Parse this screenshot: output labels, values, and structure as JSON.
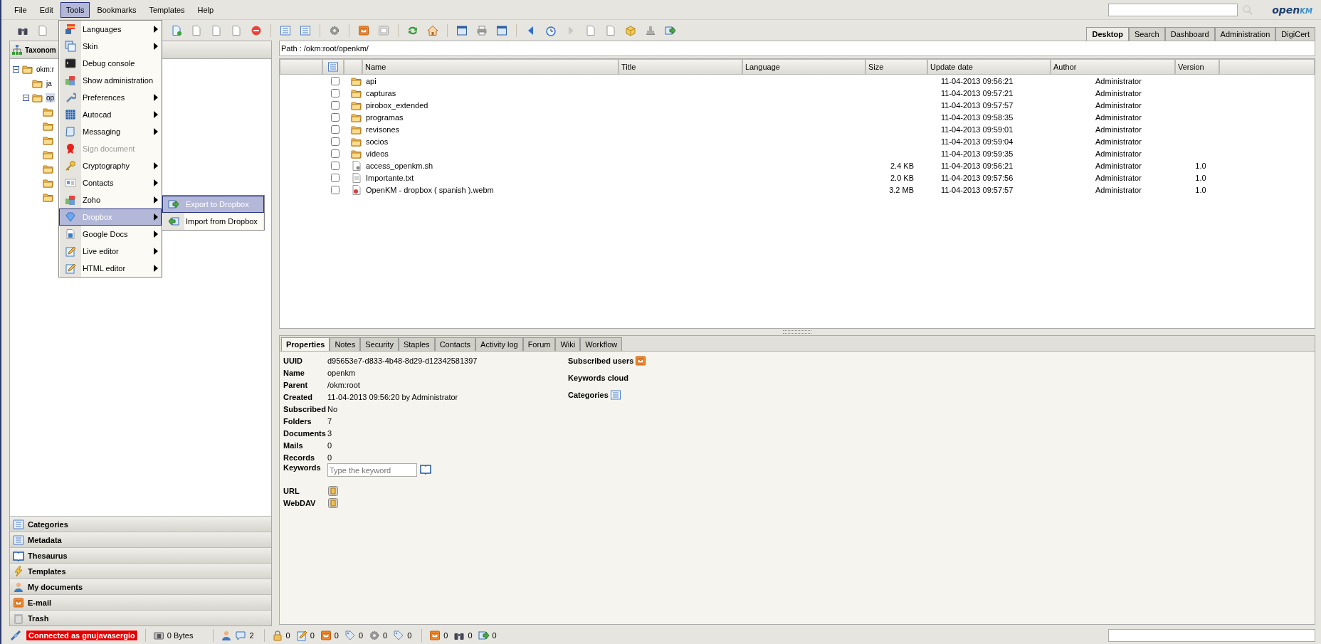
{
  "menu_bar": [
    {
      "label": "File",
      "selected": false
    },
    {
      "label": "Edit",
      "selected": false
    },
    {
      "label": "Tools",
      "selected": true
    },
    {
      "label": "Bookmarks",
      "selected": false
    },
    {
      "label": "Templates",
      "selected": false
    },
    {
      "label": "Help",
      "selected": false
    }
  ],
  "logo": {
    "main": "open",
    "tail": "KM"
  },
  "view_tabs": [
    {
      "label": "Desktop",
      "selected": true
    },
    {
      "label": "Search",
      "selected": false
    },
    {
      "label": "Dashboard",
      "selected": false
    },
    {
      "label": "Administration",
      "selected": false
    },
    {
      "label": "DigiCert",
      "selected": false
    }
  ],
  "tools_menu": [
    {
      "label": "Languages",
      "submenu": true,
      "disabled": false,
      "selected": false
    },
    {
      "label": "Skin",
      "submenu": true,
      "disabled": false,
      "selected": false
    },
    {
      "label": "Debug console",
      "submenu": false,
      "disabled": false,
      "selected": false
    },
    {
      "label": "Show administration",
      "submenu": false,
      "disabled": false,
      "selected": false
    },
    {
      "label": "Preferences",
      "submenu": true,
      "disabled": false,
      "selected": false
    },
    {
      "label": "Autocad",
      "submenu": true,
      "disabled": false,
      "selected": false
    },
    {
      "label": "Messaging",
      "submenu": true,
      "disabled": false,
      "selected": false
    },
    {
      "label": "Sign document",
      "submenu": false,
      "disabled": true,
      "selected": false
    },
    {
      "label": "Cryptography",
      "submenu": true,
      "disabled": false,
      "selected": false
    },
    {
      "label": "Contacts",
      "submenu": true,
      "disabled": false,
      "selected": false
    },
    {
      "label": "Zoho",
      "submenu": true,
      "disabled": false,
      "selected": false
    },
    {
      "label": "Dropbox",
      "submenu": true,
      "disabled": false,
      "selected": true
    },
    {
      "label": "Google Docs",
      "submenu": true,
      "disabled": false,
      "selected": false
    },
    {
      "label": "Live editor",
      "submenu": true,
      "disabled": false,
      "selected": false
    },
    {
      "label": "HTML editor",
      "submenu": true,
      "disabled": false,
      "selected": false
    }
  ],
  "dropbox_submenu": [
    {
      "label": "Export to Dropbox",
      "selected": true
    },
    {
      "label": "Import from Dropbox",
      "selected": false
    }
  ],
  "left_panel": {
    "title": "Taxonom",
    "tree": [
      {
        "label": "okm:r",
        "expanded": true,
        "selected": false,
        "children": [
          {
            "label": "ja",
            "selected": false
          },
          {
            "label": "op",
            "expanded": true,
            "selected": true,
            "children": [
              {
                "selected": false
              },
              {
                "selected": false
              },
              {
                "selected": false
              },
              {
                "selected": false
              },
              {
                "selected": false
              },
              {
                "selected": false
              },
              {
                "selected": false
              }
            ]
          }
        ]
      }
    ],
    "accordion": [
      "Categories",
      "Metadata",
      "Thesaurus",
      "Templates",
      "My documents",
      "E-mail",
      "Trash"
    ]
  },
  "path": "Path : /okm:root/openkm/",
  "table": {
    "columns": [
      "Name",
      "Title",
      "Language",
      "Size",
      "Update date",
      "Author",
      "Version"
    ],
    "rows": [
      {
        "kind": "folder",
        "checked": false,
        "name": "api",
        "size": "",
        "date": "11-04-2013 09:56:21",
        "author": "Administrator",
        "version": ""
      },
      {
        "kind": "folder",
        "checked": false,
        "name": "capturas",
        "size": "",
        "date": "11-04-2013 09:57:21",
        "author": "Administrator",
        "version": ""
      },
      {
        "kind": "folder",
        "checked": false,
        "name": "pirobox_extended",
        "size": "",
        "date": "11-04-2013 09:57:57",
        "author": "Administrator",
        "version": ""
      },
      {
        "kind": "folder",
        "checked": false,
        "name": "programas",
        "size": "",
        "date": "11-04-2013 09:58:35",
        "author": "Administrator",
        "version": ""
      },
      {
        "kind": "folder",
        "checked": false,
        "name": "revisones",
        "size": "",
        "date": "11-04-2013 09:59:01",
        "author": "Administrator",
        "version": ""
      },
      {
        "kind": "folder",
        "checked": false,
        "name": "socios",
        "size": "",
        "date": "11-04-2013 09:59:04",
        "author": "Administrator",
        "version": ""
      },
      {
        "kind": "folder",
        "checked": false,
        "name": "videos",
        "size": "",
        "date": "11-04-2013 09:59:35",
        "author": "Administrator",
        "version": ""
      },
      {
        "kind": "script",
        "checked": false,
        "name": "access_openkm.sh",
        "size": "2.4 KB",
        "date": "11-04-2013 09:56:21",
        "author": "Administrator",
        "version": "1.0"
      },
      {
        "kind": "text",
        "checked": false,
        "name": "Importante.txt",
        "size": "2.0 KB",
        "date": "11-04-2013 09:57:56",
        "author": "Administrator",
        "version": "1.0"
      },
      {
        "kind": "video",
        "checked": false,
        "name": "OpenKM - dropbox ( spanish ).webm",
        "size": "3.2 MB",
        "date": "11-04-2013 09:57:57",
        "author": "Administrator",
        "version": "1.0"
      }
    ]
  },
  "detail_tabs": [
    {
      "label": "Properties",
      "selected": true
    },
    {
      "label": "Notes",
      "selected": false
    },
    {
      "label": "Security",
      "selected": false
    },
    {
      "label": "Staples",
      "selected": false
    },
    {
      "label": "Contacts",
      "selected": false
    },
    {
      "label": "Activity log",
      "selected": false
    },
    {
      "label": "Forum",
      "selected": false
    },
    {
      "label": "Wiki",
      "selected": false
    },
    {
      "label": "Workflow",
      "selected": false
    }
  ],
  "properties": [
    {
      "kind": "text",
      "label": "UUID",
      "value": "d95653e7-d833-4b48-8d29-d12342581397"
    },
    {
      "kind": "text",
      "label": "Name",
      "value": "openkm"
    },
    {
      "kind": "text",
      "label": "Parent",
      "value": "/okm:root"
    },
    {
      "kind": "text",
      "label": "Created",
      "value": "11-04-2013 09:56:20 by Administrator"
    },
    {
      "kind": "text",
      "label": "Subscribed",
      "value": "No"
    },
    {
      "kind": "text",
      "label": "Folders",
      "value": "7"
    },
    {
      "kind": "text",
      "label": "Documents",
      "value": "3"
    },
    {
      "kind": "text",
      "label": "Mails",
      "value": "0"
    },
    {
      "kind": "text",
      "label": "Records",
      "value": "0"
    },
    {
      "kind": "field",
      "label": "Keywords",
      "placeholder": "Type the keyword"
    },
    {
      "kind": "copy",
      "label": "URL"
    },
    {
      "kind": "copy",
      "label": "WebDAV"
    }
  ],
  "side_properties": [
    "Subscribed users",
    "Keywords cloud",
    "Categories"
  ],
  "status_bar": {
    "connection": "Connected as gnujavasergio",
    "storage": "0 Bytes",
    "chat_count": "2",
    "groups": [
      [
        "0",
        "0",
        "0",
        "0",
        "0",
        "0"
      ],
      [
        "0",
        "0",
        "0"
      ]
    ]
  }
}
